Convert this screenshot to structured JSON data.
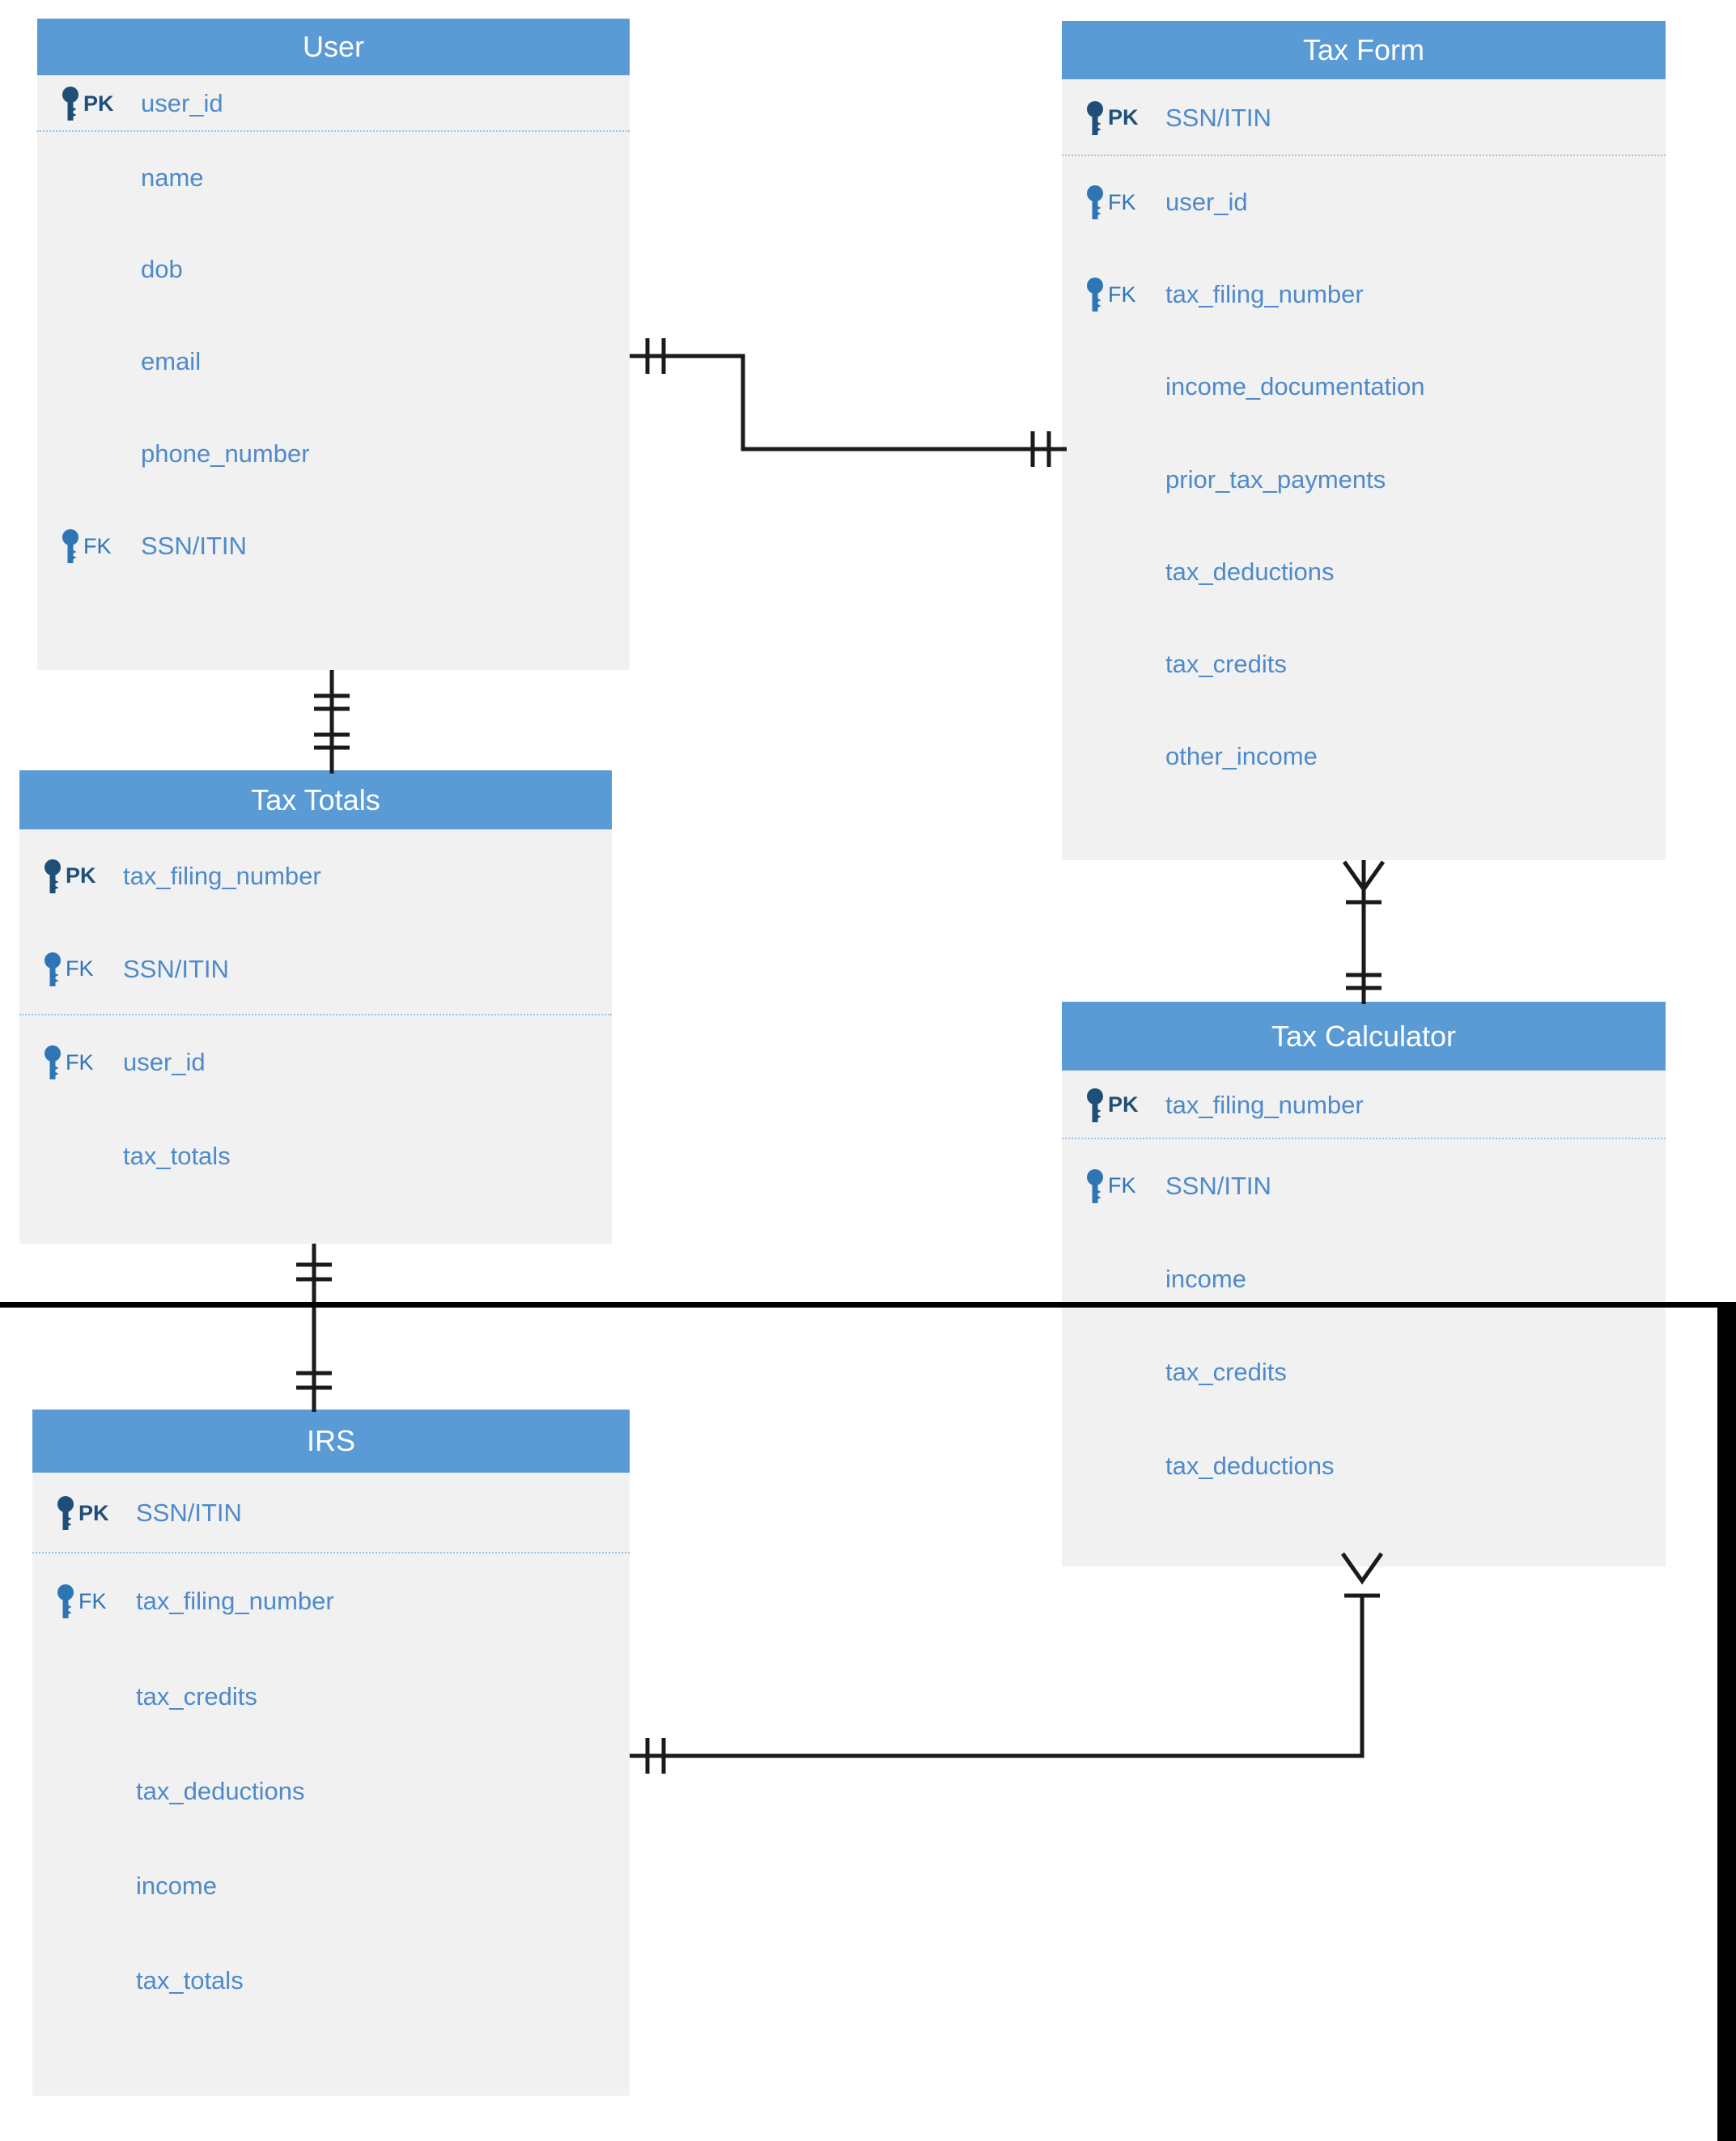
{
  "diagram": {
    "type": "entity-relationship-diagram",
    "notation": "crows-foot",
    "colors": {
      "header_fill": "#5B9BD5",
      "body_fill": "#F1F1F1",
      "header_text": "#FFFFFF",
      "attribute_text": "#4E8ACB",
      "pk_accent": "#1F4E79",
      "fk_accent": "#2E75B6",
      "connector": "#1A1A1A",
      "page_edge": "#000000"
    },
    "entities": [
      {
        "id": "user",
        "title": "User",
        "separator_after_index": 0,
        "attributes": [
          {
            "key": "PK",
            "icon": "key-icon",
            "name": "user_id"
          },
          {
            "key": "",
            "icon": "",
            "name": "name"
          },
          {
            "key": "",
            "icon": "",
            "name": "dob"
          },
          {
            "key": "",
            "icon": "",
            "name": "email"
          },
          {
            "key": "",
            "icon": "",
            "name": "phone_number"
          },
          {
            "key": "FK",
            "icon": "key-icon",
            "name": "SSN/ITIN"
          }
        ]
      },
      {
        "id": "tax_form",
        "title": "Tax Form",
        "separator_after_index": 0,
        "attributes": [
          {
            "key": "PK",
            "icon": "key-icon",
            "name": "SSN/ITIN"
          },
          {
            "key": "FK",
            "icon": "key-icon",
            "name": "user_id"
          },
          {
            "key": "FK",
            "icon": "key-icon",
            "name": "tax_filing_number"
          },
          {
            "key": "",
            "icon": "",
            "name": "income_documentation"
          },
          {
            "key": "",
            "icon": "",
            "name": "prior_tax_payments"
          },
          {
            "key": "",
            "icon": "",
            "name": "tax_deductions"
          },
          {
            "key": "",
            "icon": "",
            "name": "tax_credits"
          },
          {
            "key": "",
            "icon": "",
            "name": "other_income"
          }
        ]
      },
      {
        "id": "tax_totals",
        "title": "Tax Totals",
        "separator_after_index": 1,
        "attributes": [
          {
            "key": "PK",
            "icon": "key-icon",
            "name": "tax_filing_number"
          },
          {
            "key": "FK",
            "icon": "key-icon",
            "name": "SSN/ITIN"
          },
          {
            "key": "FK",
            "icon": "key-icon",
            "name": "user_id"
          },
          {
            "key": "",
            "icon": "",
            "name": "tax_totals"
          }
        ]
      },
      {
        "id": "tax_calculator",
        "title": "Tax Calculator",
        "separator_after_index": 0,
        "attributes": [
          {
            "key": "PK",
            "icon": "key-icon",
            "name": "tax_filing_number"
          },
          {
            "key": "FK",
            "icon": "key-icon",
            "name": "SSN/ITIN"
          },
          {
            "key": "",
            "icon": "",
            "name": "income"
          },
          {
            "key": "",
            "icon": "",
            "name": "tax_credits"
          },
          {
            "key": "",
            "icon": "",
            "name": "tax_deductions"
          }
        ]
      },
      {
        "id": "irs",
        "title": "IRS",
        "separator_after_index": 0,
        "attributes": [
          {
            "key": "PK",
            "icon": "key-icon",
            "name": "SSN/ITIN"
          },
          {
            "key": "FK",
            "icon": "key-icon",
            "name": "tax_filing_number"
          },
          {
            "key": "",
            "icon": "",
            "name": "tax_credits"
          },
          {
            "key": "",
            "icon": "",
            "name": "tax_deductions"
          },
          {
            "key": "",
            "icon": "",
            "name": "income"
          },
          {
            "key": "",
            "icon": "",
            "name": "tax_totals"
          }
        ]
      }
    ],
    "relationships": [
      {
        "id": "user-taxform",
        "from": "user",
        "to": "tax_form",
        "from_cardinality": "one-and-only-one",
        "to_cardinality": "one-and-only-one"
      },
      {
        "id": "user-taxtotals",
        "from": "user",
        "to": "tax_totals",
        "from_cardinality": "one-and-only-one",
        "to_cardinality": "one-and-only-one"
      },
      {
        "id": "taxform-taxcalc",
        "from": "tax_form",
        "to": "tax_calculator",
        "from_cardinality": "one-to-many",
        "to_cardinality": "one-and-only-one"
      },
      {
        "id": "taxtotals-irs",
        "from": "tax_totals",
        "to": "irs",
        "from_cardinality": "one-and-only-one",
        "to_cardinality": "one-and-only-one"
      },
      {
        "id": "irs-taxcalc",
        "from": "irs",
        "to": "tax_calculator",
        "from_cardinality": "one-and-only-one",
        "to_cardinality": "one-to-many"
      }
    ]
  }
}
